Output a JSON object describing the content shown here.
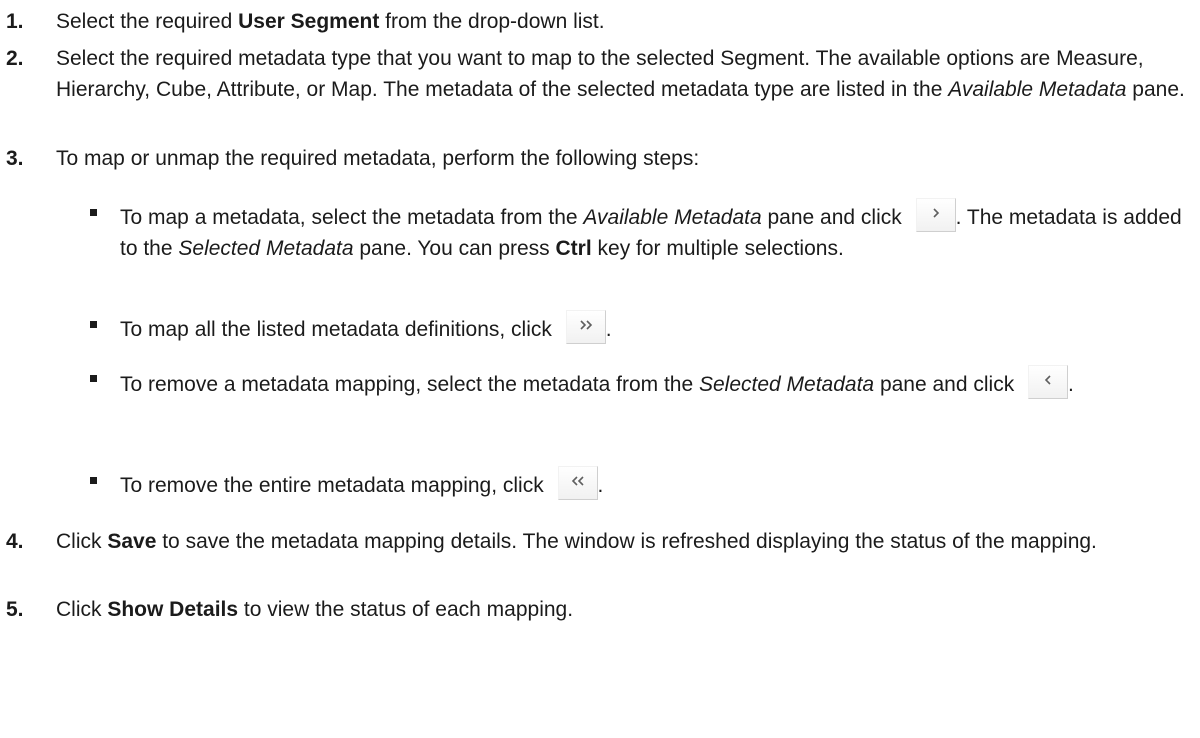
{
  "steps": [
    {
      "num": "1.",
      "pre": "Select the required ",
      "bold": "User Segment",
      "post": " from the drop-down list."
    },
    {
      "num": "2.",
      "pre": "Select the required metadata type that you want to map to the selected Segment. The available options are Measure, Hierarchy, Cube, Attribute, or Map. The metadata of the selected metadata type are listed in the ",
      "italic": "Available Metadata",
      "post": " pane."
    },
    {
      "num": "3.",
      "text": "To map or unmap the required metadata, perform the following steps:"
    },
    {
      "num": "4.",
      "pre": "Click ",
      "bold": "Save",
      "post": " to save the metadata mapping details. The window is refreshed displaying the status of the mapping."
    },
    {
      "num": "5.",
      "pre": "Click ",
      "bold": "Show Details",
      "post": " to view the status of each mapping."
    }
  ],
  "substeps": [
    {
      "t1": "To map a metadata, select the metadata from the ",
      "i1": "Available Metadata",
      "t2": " pane and click ",
      "t3": ". The metadata is added to the ",
      "i2": "Selected Metadata",
      "t4": " pane. You can press ",
      "b1": "Ctrl",
      "t5": " key for multiple selections."
    },
    {
      "t1": "To map all the listed metadata definitions, click ",
      "t2": "."
    },
    {
      "t1": "To remove a metadata mapping, select the metadata from the ",
      "i1": "Selected Metadata",
      "t2": " pane and click ",
      "t3": "."
    },
    {
      "t1": "To remove the entire metadata mapping, click ",
      "t2": "."
    }
  ],
  "icons": {
    "move_right": "chevron-right-icon",
    "move_all_right": "double-chevron-right-icon",
    "move_left": "chevron-left-icon",
    "move_all_left": "double-chevron-left-icon"
  },
  "colors": {
    "text": "#1b1b1b",
    "button_bg": "#f1f1f1",
    "button_border": "#cfcfcf",
    "icon": "#5f5f5f"
  }
}
